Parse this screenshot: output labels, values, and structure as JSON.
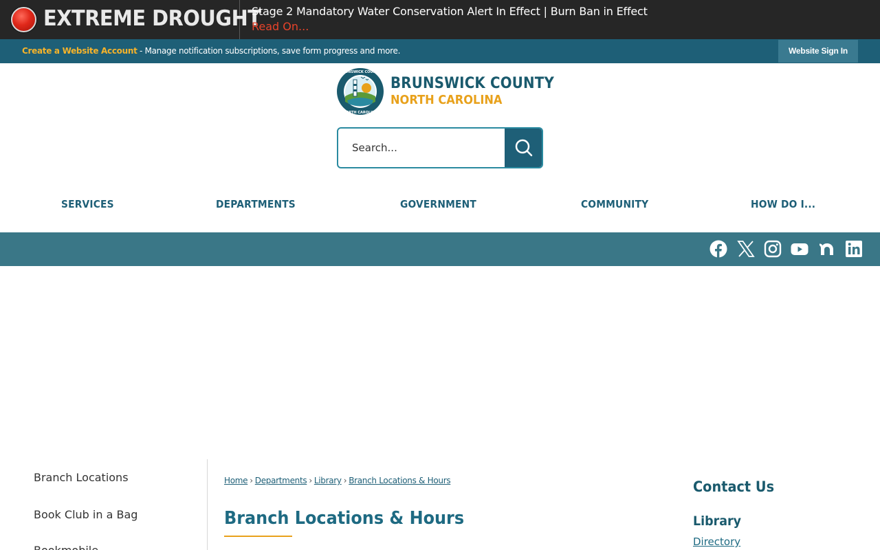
{
  "alert": {
    "title": "EXTREME DROUGHT",
    "message": "Stage 2 Mandatory Water Conservation Alert In Effect | Burn Ban in Effect",
    "link": "Read On..."
  },
  "account_bar": {
    "create_link": "Create a Website Account",
    "message": " - Manage notification subscriptions, save form progress and more.",
    "sign_in": "Website Sign In"
  },
  "logo": {
    "line1": "BRUNSWICK COUNTY",
    "line2": "NORTH CAROLINA",
    "seal_text_top": "BRUNSWICK COUNTY",
    "seal_text_bottom": "NORTH CAROLINA"
  },
  "search": {
    "placeholder": "Search..."
  },
  "nav": {
    "items": [
      {
        "label": "SERVICES"
      },
      {
        "label": "DEPARTMENTS"
      },
      {
        "label": "GOVERNMENT"
      },
      {
        "label": "COMMUNITY"
      },
      {
        "label": "HOW DO I..."
      }
    ]
  },
  "social": [
    "facebook-icon",
    "x-icon",
    "instagram-icon",
    "youtube-icon",
    "nextdoor-icon",
    "linkedin-icon"
  ],
  "side_nav": {
    "items": [
      {
        "label": "Branch Locations"
      },
      {
        "label": "Book Club in a Bag"
      },
      {
        "label": "Bookmobile"
      }
    ]
  },
  "breadcrumb": {
    "items": [
      {
        "label": "Home"
      },
      {
        "label": "Departments"
      },
      {
        "label": "Library"
      },
      {
        "label": "Branch Locations & Hours"
      }
    ],
    "separator": "›"
  },
  "page": {
    "title": "Branch Locations & Hours"
  },
  "contact": {
    "title": "Contact Us",
    "department": "Library",
    "link": "Directory"
  },
  "colors": {
    "alert_bg": "#262626",
    "account_bar": "#1e5f77",
    "brand_teal": "#1e5f77",
    "brand_gold": "#e8a11b",
    "alert_link": "#e8432a",
    "social_bar": "#3a7787"
  }
}
